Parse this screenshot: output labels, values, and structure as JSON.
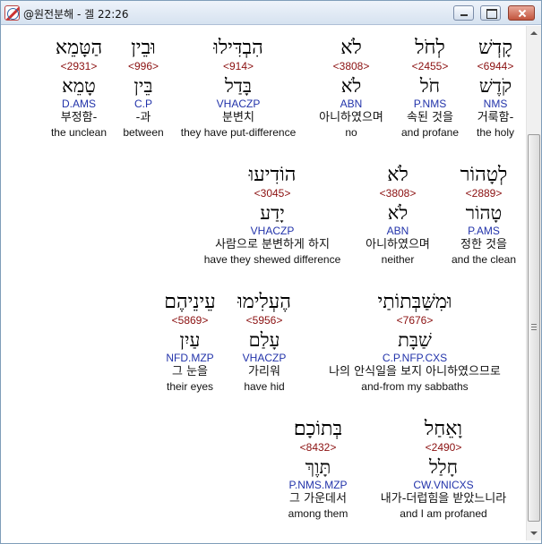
{
  "window": {
    "title": "@원전분해 - 겔 22:26"
  },
  "rows": [
    [
      {
        "hebrew": "קָדְשׁ",
        "strong": "<6944>",
        "lexeme": "קֹדֶשׁ",
        "morph": "NMS",
        "korean": "거룩함-",
        "english": "the holy"
      },
      {
        "hebrew": "לְחֹל",
        "strong": "<2455>",
        "lexeme": "חֹל",
        "morph": "P.NMS",
        "korean": "속된 것을",
        "english": "and profane"
      },
      {
        "hebrew": "לֹא",
        "strong": "<3808>",
        "lexeme": "לֹא",
        "morph": "ABN",
        "korean": "아니하였으며",
        "english": "no"
      },
      {
        "hebrew": "הִבְדִּילוּ",
        "strong": "<914>",
        "lexeme": "בָּדַל",
        "morph": "VHACZP",
        "korean": "분변치",
        "english": "they have put-difference"
      },
      {
        "hebrew": "וּבֵין",
        "strong": "<996>",
        "lexeme": "בֵּין",
        "morph": "C.P",
        "korean": "-과",
        "english": "between"
      },
      {
        "hebrew": "הַטָּמֵא",
        "strong": "<2931>",
        "lexeme": "טָמֵא",
        "morph": "D.AMS",
        "korean": "부정함-",
        "english": "the unclean"
      }
    ],
    [
      {
        "hebrew": "לְטָהוֹר",
        "strong": "<2889>",
        "lexeme": "טָהוֹר",
        "morph": "P.AMS",
        "korean": "정한 것을",
        "english": "and the clean"
      },
      {
        "hebrew": "לֹא",
        "strong": "<3808>",
        "lexeme": "לֹא",
        "morph": "ABN",
        "korean": "아니하였으며",
        "english": "neither"
      },
      {
        "hebrew": "הוֹדִיעוּ",
        "strong": "<3045>",
        "lexeme": "יָדַע",
        "morph": "VHACZP",
        "korean": "사람으로 분변하게 하지",
        "english": "have they shewed difference"
      }
    ],
    [
      {
        "hebrew": "וּמִשַּׁבְּתוֹתַי",
        "strong": "<7676>",
        "lexeme": "שַׁבָּת",
        "morph": "C.P.NFP.CXS",
        "korean": "나의 안식일을 보지 아니하였으므로",
        "english": "and-from my sabbaths"
      },
      {
        "hebrew": "הֶעְלִימוּ",
        "strong": "<5956>",
        "lexeme": "עָלַם",
        "morph": "VHACZP",
        "korean": "가리워",
        "english": "have hid"
      },
      {
        "hebrew": "עֵינֵיהֶם",
        "strong": "<5869>",
        "lexeme": "עַיִן",
        "morph": "NFD.MZP",
        "korean": "그 눈을",
        "english": "their eyes"
      }
    ],
    [
      {
        "hebrew": "וָאֵחַל",
        "strong": "<2490>",
        "lexeme": "חָלַל",
        "morph": "CW.VNICXS",
        "korean": "내가-더럽힘을 받았느니라",
        "english": "and I am profaned"
      },
      {
        "hebrew": "בְּתוֹכָם׃",
        "strong": "<8432>",
        "lexeme": "תָּוֶךְ",
        "morph": "P.NMS.MZP",
        "korean": "그 가운데서",
        "english": "among them"
      }
    ]
  ]
}
